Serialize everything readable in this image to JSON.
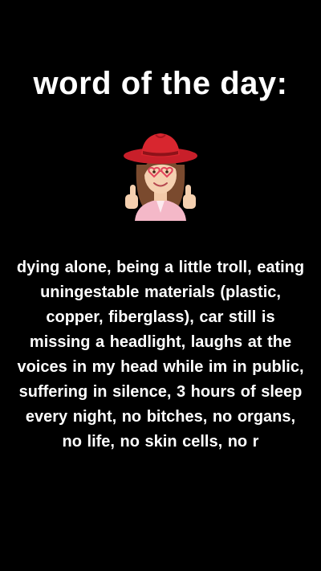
{
  "title": "word of the day:",
  "sticker": {
    "icon": "cowgirl-memoji-thumbs-up",
    "hat_color": "#d8262f",
    "hair_color": "#7a4a2e",
    "shirt_color": "#f4b8c8"
  },
  "body_text": "dying alone, being a little troll, eating uningestable materials (plastic, copper, fiberglass), car still is missing a headlight, laughs at the voices in my head while im in public, suffering in silence, 3 hours of sleep every night, no bitches, no organs, no life, no skin cells, no r"
}
